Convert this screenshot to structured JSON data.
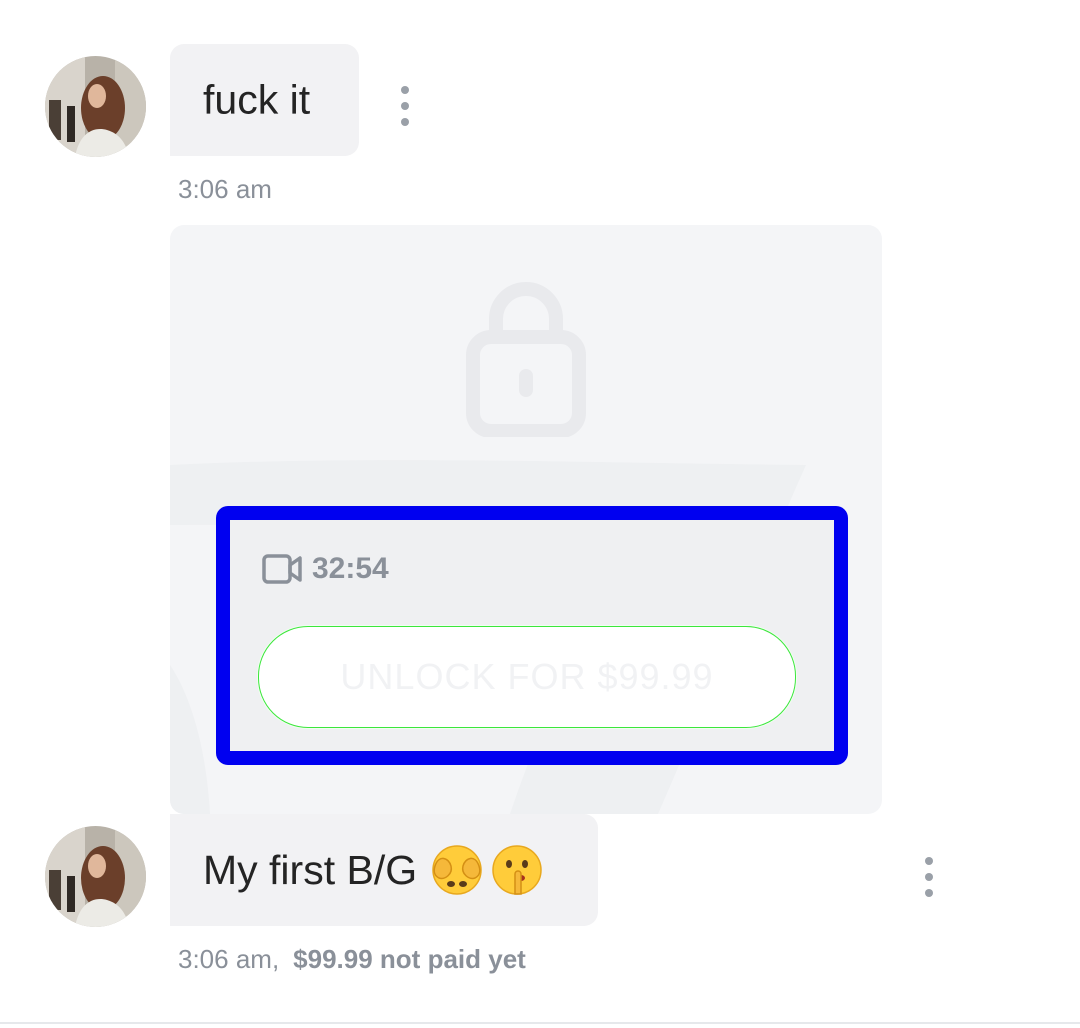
{
  "messages": [
    {
      "text": "fuck it",
      "time": "3:06 am"
    },
    {
      "text": "My first B/G",
      "emojis": [
        "face-with-open-eyes-and-hand-over-mouth",
        "shushing-face"
      ],
      "time": "3:06 am,",
      "price_status": "$99.99 not paid yet"
    }
  ],
  "locked_media": {
    "duration": "32:54",
    "unlock_label": "UNLOCK FOR $99.99"
  },
  "colors": {
    "bubble_bg": "#f2f2f4",
    "card_bg": "#f4f5f7",
    "highlight_border": "#0000f0",
    "muted_text": "#8a9099"
  }
}
